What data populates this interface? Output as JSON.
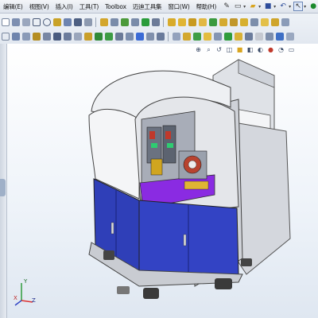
{
  "menu": {
    "items": [
      {
        "label": "编辑(E)"
      },
      {
        "label": "视图(V)"
      },
      {
        "label": "插入(I)"
      },
      {
        "label": "工具(T)"
      },
      {
        "label": "Toolbox"
      },
      {
        "label": "迈迪工具集"
      },
      {
        "label": "窗口(W)"
      },
      {
        "label": "帮助(H)"
      }
    ]
  },
  "axis": {
    "x": "X",
    "y": "Y",
    "z": "Z"
  },
  "colors": {
    "accent": "#3b6bd6",
    "cabinet_blue": "#2f3fb8",
    "frame_gray": "#c9ccd2",
    "purple": "#8a2be2",
    "background_top": "#ffffff",
    "background_bottom": "#dfe7f1"
  },
  "icons": {
    "menu_toolbar": [
      "new-document-icon",
      "open-folder-icon",
      "save-icon",
      "print-icon",
      "undo-icon",
      "select-pointer-icon",
      "rebuild-icon"
    ],
    "view_toolbar": [
      "zoom-to-fit-icon",
      "zoom-area-icon",
      "previous-view-icon",
      "section-view-icon",
      "view-orientation-icon",
      "display-style-icon",
      "hide-show-icon",
      "appearance-icon",
      "scene-icon",
      "view-settings-icon"
    ]
  }
}
